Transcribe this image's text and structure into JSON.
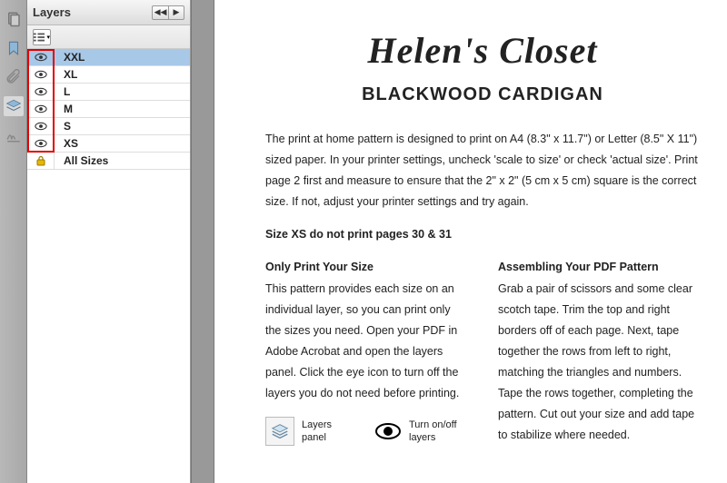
{
  "panel": {
    "title": "Layers",
    "items": [
      {
        "label": "XXL",
        "visible": true,
        "locked": false,
        "selected": true
      },
      {
        "label": "XL",
        "visible": true,
        "locked": false,
        "selected": false
      },
      {
        "label": "L",
        "visible": true,
        "locked": false,
        "selected": false
      },
      {
        "label": "M",
        "visible": true,
        "locked": false,
        "selected": false
      },
      {
        "label": "S",
        "visible": true,
        "locked": false,
        "selected": false
      },
      {
        "label": "XS",
        "visible": true,
        "locked": false,
        "selected": false
      },
      {
        "label": "All Sizes",
        "visible": true,
        "locked": true,
        "selected": false
      }
    ]
  },
  "document": {
    "brand": "Helen's Closet",
    "product": "BLACKWOOD CARDIGAN",
    "intro": "The print at home pattern is designed to print on A4 (8.3\" x 11.7\") or Letter (8.5\" X 11\") sized paper.  In your printer settings, uncheck 'scale to size' or check 'actual size'.  Print page 2 first and measure to ensure that the 2\" x 2\" (5 cm x 5 cm) square is the correct size.  If not, adjust your printer settings and try again.",
    "note": "Size XS do not print pages 30 & 31",
    "col1_heading": "Only Print Your Size",
    "col1_body": "This pattern provides each size on an individual layer, so you can print only the sizes you need. Open your PDF in Adobe Acrobat and open the layers panel.  Click the eye icon to turn off the layers you do not need before printing.",
    "col2_heading": "Assembling Your PDF Pattern",
    "col2_body": "Grab a pair of scissors and some clear scotch tape. Trim the top and right borders off of each page.  Next, tape together the rows from left to right, matching the triangles and numbers.  Tape the rows together, completing the pattern.  Cut out your size and add tape to stabilize where needed.",
    "legend_layers": "Layers panel",
    "legend_eye": "Turn on/off layers"
  }
}
